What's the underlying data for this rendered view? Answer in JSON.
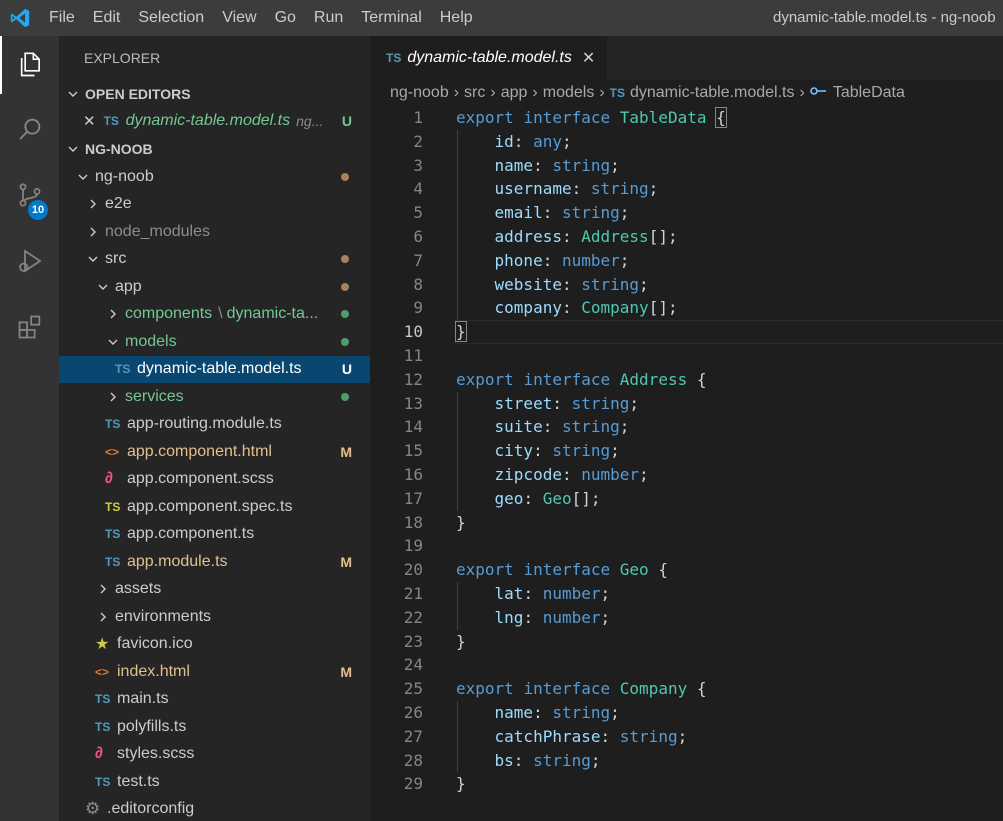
{
  "menu": [
    "File",
    "Edit",
    "Selection",
    "View",
    "Go",
    "Run",
    "Terminal",
    "Help"
  ],
  "window_title": "dynamic-table.model.ts - ng-noob",
  "activity_bar": {
    "items": [
      "explorer-icon",
      "search-icon",
      "source-control-icon",
      "run-debug-icon",
      "extensions-icon"
    ],
    "scm_badge": "10"
  },
  "sidebar": {
    "title": "EXPLORER",
    "open_editors_header": "OPEN EDITORS",
    "open_editor": {
      "icon": "TS",
      "name": "dynamic-table.model.ts",
      "path": "ng...",
      "status": "U"
    },
    "project_header": "NG-NOOB",
    "tree": [
      {
        "label": "ng-noob",
        "kind": "folder-open",
        "status": "dot-brown"
      },
      {
        "label": "e2e",
        "kind": "folder"
      },
      {
        "label": "node_modules",
        "kind": "folder"
      },
      {
        "label": "src",
        "kind": "folder-open",
        "status": "dot-brown"
      },
      {
        "label": "app",
        "kind": "folder-open",
        "status": "dot-brown"
      },
      {
        "label": "components",
        "kind": "folder",
        "suffix": "dynamic-ta...",
        "status": "dot-green"
      },
      {
        "label": "models",
        "kind": "folder-open",
        "status": "dot-green"
      },
      {
        "label": "dynamic-table.model.ts",
        "kind": "file",
        "icon": "TS",
        "status": "U"
      },
      {
        "label": "services",
        "kind": "folder",
        "status": "dot-green"
      },
      {
        "label": "app-routing.module.ts",
        "kind": "file",
        "icon": "TS"
      },
      {
        "label": "app.component.html",
        "kind": "file",
        "icon": "<>",
        "status": "M"
      },
      {
        "label": "app.component.scss",
        "kind": "file",
        "icon": "scss"
      },
      {
        "label": "app.component.spec.ts",
        "kind": "file",
        "icon": "TS"
      },
      {
        "label": "app.component.ts",
        "kind": "file",
        "icon": "TS"
      },
      {
        "label": "app.module.ts",
        "kind": "file",
        "icon": "TS",
        "status": "M"
      },
      {
        "label": "assets",
        "kind": "folder"
      },
      {
        "label": "environments",
        "kind": "folder"
      },
      {
        "label": "favicon.ico",
        "kind": "file",
        "icon": "star"
      },
      {
        "label": "index.html",
        "kind": "file",
        "icon": "<>",
        "status": "M"
      },
      {
        "label": "main.ts",
        "kind": "file",
        "icon": "TS"
      },
      {
        "label": "polyfills.ts",
        "kind": "file",
        "icon": "TS"
      },
      {
        "label": "styles.scss",
        "kind": "file",
        "icon": "scss"
      },
      {
        "label": "test.ts",
        "kind": "file",
        "icon": "TS"
      },
      {
        "label": ".editorconfig",
        "kind": "file",
        "icon": "gear"
      }
    ]
  },
  "editor": {
    "tab": {
      "icon": "TS",
      "label": "dynamic-table.model.ts",
      "close": "✕"
    },
    "breadcrumbs": [
      "ng-noob",
      "src",
      "app",
      "models",
      "dynamic-table.model.ts",
      "TableData"
    ],
    "breadcrumb_file_icon": "TS",
    "current_line": 10,
    "lines": [
      "export interface TableData {",
      "    id: any;",
      "    name: string;",
      "    username: string;",
      "    email: string;",
      "    address: Address[];",
      "    phone: number;",
      "    website: string;",
      "    company: Company[];",
      "}",
      "",
      "export interface Address {",
      "    street: string;",
      "    suite: string;",
      "    city: string;",
      "    zipcode: number;",
      "    geo: Geo[];",
      "}",
      "",
      "export interface Geo {",
      "    lat: number;",
      "    lng: number;",
      "}",
      "",
      "export interface Company {",
      "    name: string;",
      "    catchPhrase: string;",
      "    bs: string;",
      "}"
    ]
  }
}
